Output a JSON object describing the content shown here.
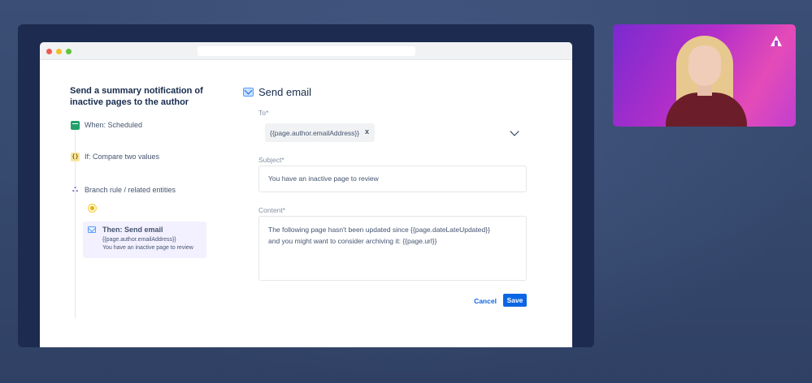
{
  "rule": {
    "title": "Send a summary notification of inactive pages to the author",
    "steps": [
      {
        "label": "When: Scheduled",
        "icon": "calendar-icon"
      },
      {
        "label": "If: Compare two values",
        "icon": "braces-icon"
      },
      {
        "label": "Branch rule / related entities",
        "icon": "branch-icon"
      }
    ],
    "action": {
      "title": "Then: Send email",
      "line1": "{{page.author.emailAddress}}",
      "line2": "You have an inactive page to review"
    }
  },
  "email": {
    "header": "Send email",
    "to_label": "To*",
    "to_value": "{{page.author.emailAddress}}",
    "to_remove": "x",
    "subject_label": "Subject*",
    "subject_value": "You have an inactive page to review",
    "content_label": "Content*",
    "content_line1": "The following page hasn't been updated since {{page.dateLateUpdated}}",
    "content_line2": "and you might want to consider archiving it: {{page.url}}",
    "cancel_label": "Cancel",
    "save_label": "Save"
  },
  "colors": {
    "primary": "#0c66e4",
    "background": "#34476b",
    "webcam_gradient_start": "#7a2ad0",
    "webcam_gradient_end": "#e44bb8"
  }
}
